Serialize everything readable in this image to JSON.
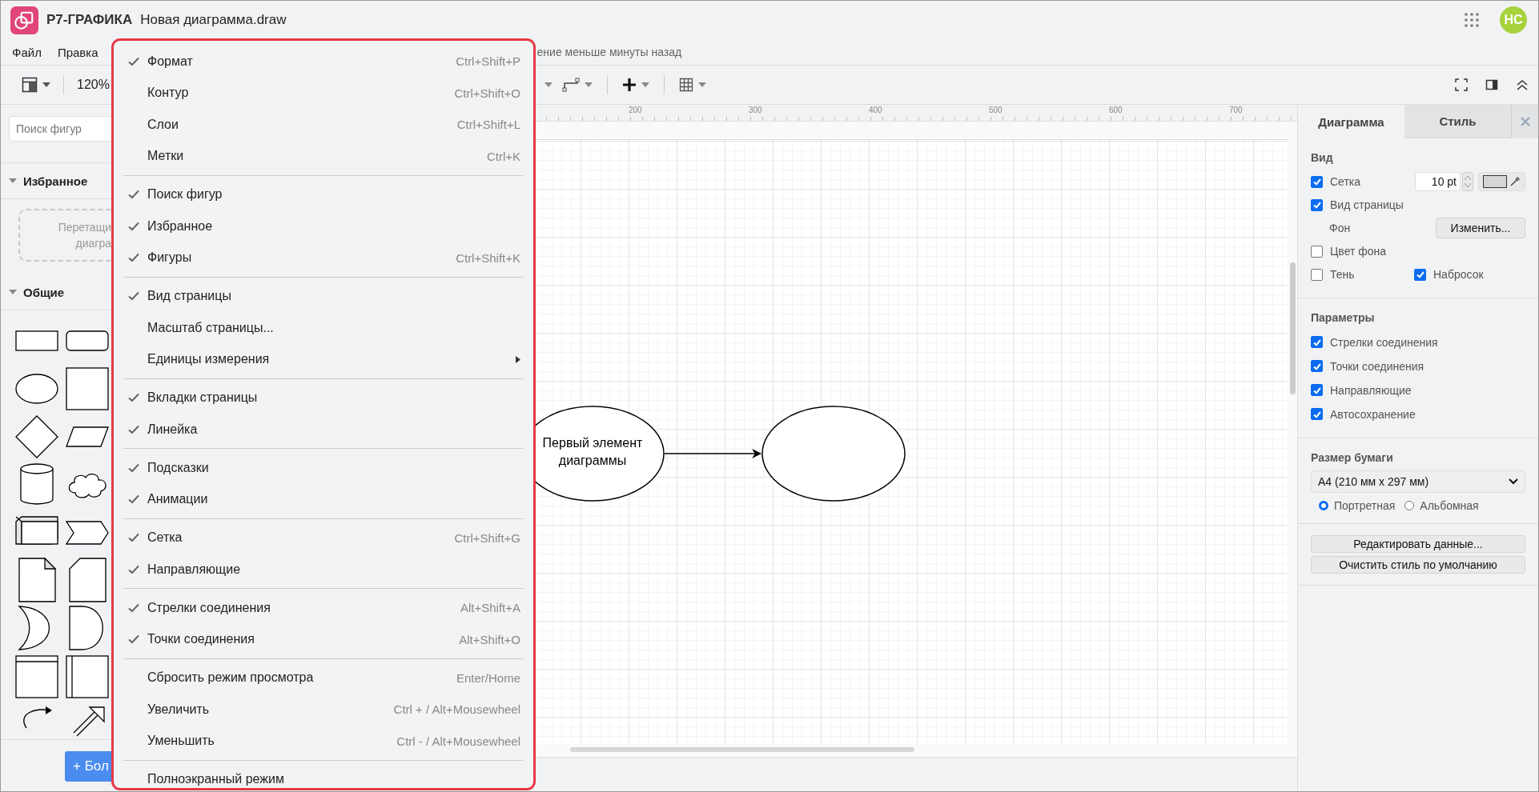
{
  "app": {
    "name": "Р7-ГРАФИКА",
    "file_name": "Новая диаграмма.draw",
    "avatar": "НС"
  },
  "menubar": {
    "items": [
      "Файл",
      "Правка"
    ],
    "save_status": "ение меньше минуты назад"
  },
  "toolbar": {
    "zoom": "120%"
  },
  "sidebar": {
    "search": {
      "placeholder": "Поиск фигур"
    },
    "sections": [
      {
        "title": "Избранное",
        "expanded": true,
        "hint_lines": [
          "Перетащи",
          "диагра"
        ]
      },
      {
        "title": "Общие",
        "expanded": true
      }
    ],
    "more_button": "+ Бол"
  },
  "ruler": {
    "labels": [
      "200",
      "300",
      "400",
      "500",
      "600",
      "700"
    ]
  },
  "diagram": {
    "nodes": [
      {
        "kind": "ellipse",
        "label": "Первый элемент диаграммы"
      },
      {
        "kind": "ellipse"
      }
    ]
  },
  "view_menu": {
    "groups": [
      [
        {
          "kind": "item",
          "label": "Формат",
          "shortcut": "Ctrl+Shift+P",
          "checked": true
        },
        {
          "kind": "item",
          "label": "Контур",
          "shortcut": "Ctrl+Shift+O",
          "checked": false
        },
        {
          "kind": "item",
          "label": "Слои",
          "shortcut": "Ctrl+Shift+L",
          "checked": false
        },
        {
          "kind": "item",
          "label": "Метки",
          "shortcut": "Ctrl+K",
          "checked": false
        }
      ],
      [
        {
          "kind": "item",
          "label": "Поиск фигур",
          "checked": true
        },
        {
          "kind": "item",
          "label": "Избранное",
          "checked": true
        },
        {
          "kind": "item",
          "label": "Фигуры",
          "shortcut": "Ctrl+Shift+K",
          "checked": true
        }
      ],
      [
        {
          "kind": "item",
          "label": "Вид страницы",
          "checked": true
        },
        {
          "kind": "item",
          "label": "Масштаб страницы...",
          "checked": false
        },
        {
          "kind": "submenu",
          "label": "Единицы измерения",
          "checked": false
        }
      ],
      [
        {
          "kind": "item",
          "label": "Вкладки страницы",
          "checked": true
        },
        {
          "kind": "item",
          "label": "Линейка",
          "checked": true
        }
      ],
      [
        {
          "kind": "item",
          "label": "Подсказки",
          "checked": true
        },
        {
          "kind": "item",
          "label": "Анимации",
          "checked": true
        }
      ],
      [
        {
          "kind": "item",
          "label": "Сетка",
          "shortcut": "Ctrl+Shift+G",
          "checked": true
        },
        {
          "kind": "item",
          "label": "Направляющие",
          "checked": true
        }
      ],
      [
        {
          "kind": "item",
          "label": "Стрелки соединения",
          "shortcut": "Alt+Shift+A",
          "checked": true
        },
        {
          "kind": "item",
          "label": "Точки соединения",
          "shortcut": "Alt+Shift+O",
          "checked": true
        }
      ],
      [
        {
          "kind": "item",
          "label": "Сбросить режим просмотра",
          "shortcut": "Enter/Home",
          "checked": false
        },
        {
          "kind": "item",
          "label": "Увеличить",
          "shortcut": "Ctrl + / Alt+Mousewheel",
          "checked": false
        },
        {
          "kind": "item",
          "label": "Уменьшить",
          "shortcut": "Ctrl - / Alt+Mousewheel",
          "checked": false
        }
      ],
      [
        {
          "kind": "item",
          "label": "Полноэкранный режим",
          "checked": false
        }
      ]
    ]
  },
  "format_panel": {
    "tabs": [
      {
        "label": "Диаграмма",
        "selected": true
      },
      {
        "label": "Стиль",
        "selected": false
      }
    ],
    "view": {
      "title": "Вид",
      "grid": {
        "label": "Сетка",
        "checked": true,
        "size": "10 pt"
      },
      "page_view": {
        "label": "Вид страницы",
        "checked": true
      },
      "background": {
        "label": "Фон",
        "button": "Изменить..."
      },
      "background_color": {
        "label": "Цвет фона",
        "checked": false
      },
      "shadow": {
        "label": "Тень",
        "checked": false
      },
      "sketch": {
        "label": "Набросок",
        "checked": true
      }
    },
    "options": {
      "title": "Параметры",
      "items": [
        {
          "label": "Стрелки соединения",
          "checked": true
        },
        {
          "label": "Точки соединения",
          "checked": true
        },
        {
          "label": "Направляющие",
          "checked": true
        },
        {
          "label": "Автосохранение",
          "checked": true
        }
      ]
    },
    "paper": {
      "title": "Размер бумаги",
      "size": "A4 (210 мм x 297 мм)",
      "orientations": [
        {
          "label": "Портретная",
          "selected": true
        },
        {
          "label": "Альбомная",
          "selected": false
        }
      ]
    },
    "buttons": [
      "Редактировать данные...",
      "Очистить стиль по умолчанию"
    ]
  }
}
